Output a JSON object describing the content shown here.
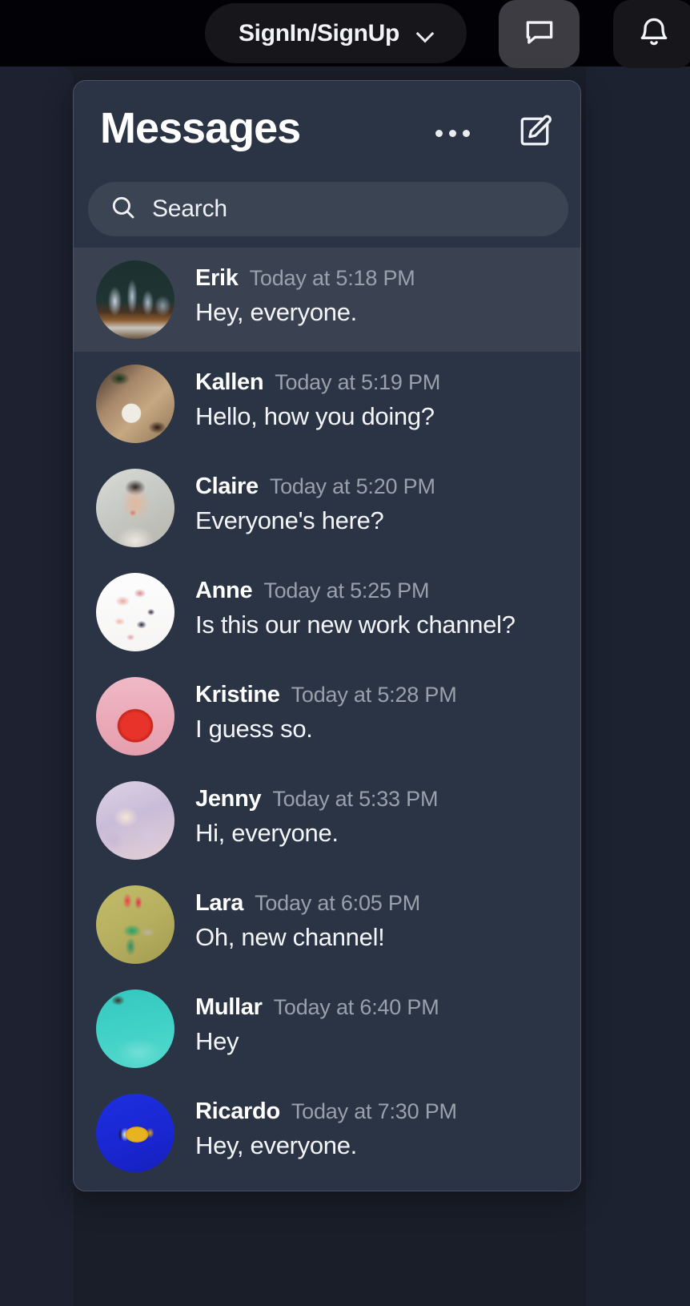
{
  "topbar": {
    "signin": {
      "label": "SignIn/SignUp",
      "chevron_icon": "chevron-down-icon"
    },
    "chat_button": {
      "icon": "chat-bubble-icon",
      "active": true,
      "bg": "#3c3c42"
    },
    "bell_button": {
      "icon": "bell-icon",
      "active": false,
      "bg": "#16161b"
    },
    "bg": "#010106"
  },
  "messages_panel": {
    "title": "Messages",
    "bg": "#2b3444",
    "border_color": "#4a5366",
    "more_button": {
      "label": "More options",
      "icon": "ellipsis-icon"
    },
    "compose_button": {
      "label": "New message",
      "icon": "compose-pencil-icon"
    },
    "search": {
      "placeholder": "Search",
      "value": "",
      "icon": "search-icon",
      "bg": "#3b4453"
    },
    "active_row_bg": "#3a4252",
    "messages": [
      {
        "name": "Erik",
        "time": "Today at 5:18 PM",
        "text": "Hey, everyone.",
        "avatar": "city-skyline-avatar",
        "avatar_class": "av-city",
        "active": true
      },
      {
        "name": "Kallen",
        "time": "Today at 5:19 PM",
        "text": "Hello, how you doing?",
        "avatar": "food-table-avatar",
        "avatar_class": "av-food",
        "active": false
      },
      {
        "name": "Claire",
        "time": "Today at 5:20 PM",
        "text": "Everyone's here?",
        "avatar": "portrait-avatar",
        "avatar_class": "av-claire",
        "active": false
      },
      {
        "name": "Anne",
        "time": "Today at 5:25 PM",
        "text": "Is this our new work channel?",
        "avatar": "flowers-avatar",
        "avatar_class": "av-flowers",
        "active": false
      },
      {
        "name": "Kristine",
        "time": "Today at 5:28 PM",
        "text": "I guess so.",
        "avatar": "strawberry-avatar",
        "avatar_class": "av-berry",
        "active": false
      },
      {
        "name": "Jenny",
        "time": "Today at 5:33 PM",
        "text": "Hi, everyone.",
        "avatar": "pink-sky-avatar",
        "avatar_class": "av-sky",
        "active": false
      },
      {
        "name": "Lara",
        "time": "Today at 6:05 PM",
        "text": "Oh, new channel!",
        "avatar": "hummingbird-avatar",
        "avatar_class": "av-bird",
        "active": false
      },
      {
        "name": "Mullar",
        "time": "Today at 6:40 PM",
        "text": "Hey",
        "avatar": "turquoise-water-avatar",
        "avatar_class": "av-water",
        "active": false
      },
      {
        "name": "Ricardo",
        "time": "Today at 7:30 PM",
        "text": "Hey, everyone.",
        "avatar": "tropical-fish-avatar",
        "avatar_class": "av-fish",
        "active": false
      }
    ]
  }
}
